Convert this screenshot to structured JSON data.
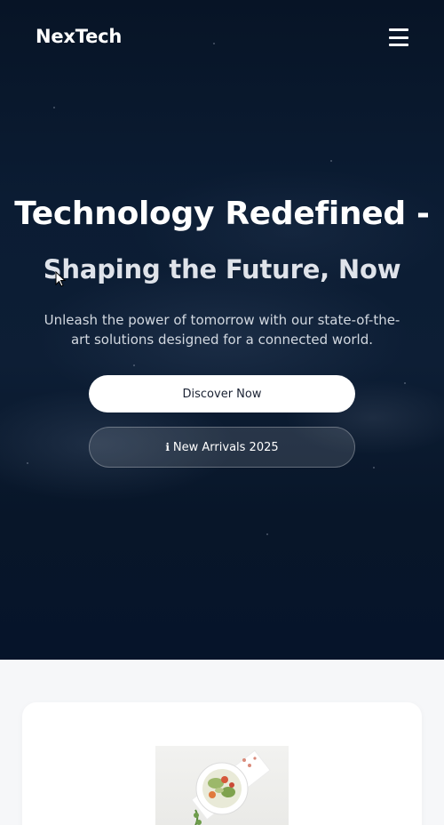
{
  "nav": {
    "logo": "NexTech",
    "menu_icon": "hamburger-menu-icon"
  },
  "hero": {
    "title": "Technology Redefined -",
    "subtitle": "Shaping the Future, Now",
    "description": "Unleash the power of tomorrow with our state-of-the-art solutions designed for a connected world.",
    "primary_button": "Discover Now",
    "secondary_button": {
      "icon": "info-icon",
      "label": "New Arrivals 2025"
    }
  },
  "card": {
    "image_icon": "salad-bowl-image"
  },
  "colors": {
    "hero_bg": "#0b1c33",
    "page_bg": "#f6f7f9",
    "primary_button_bg": "#ffffff",
    "primary_button_text": "#1a2233"
  }
}
